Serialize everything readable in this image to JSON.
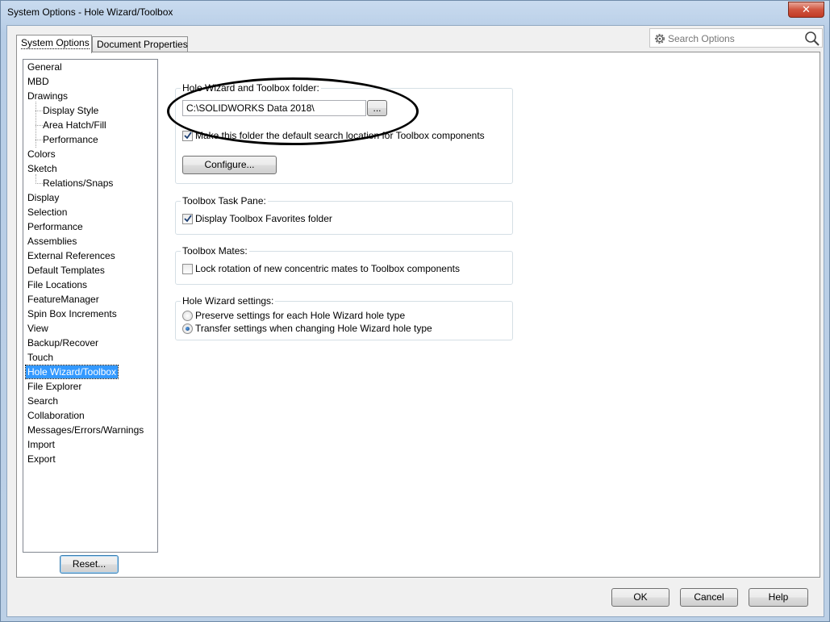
{
  "window": {
    "title": "System Options - Hole Wizard/Toolbox",
    "close_label": "✕"
  },
  "tabs": [
    {
      "label": "System Options",
      "active": true
    },
    {
      "label": "Document Properties",
      "active": false
    }
  ],
  "search": {
    "placeholder": "Search Options"
  },
  "tree": {
    "items": [
      {
        "label": "General"
      },
      {
        "label": "MBD"
      },
      {
        "label": "Drawings"
      },
      {
        "label": "Display Style"
      },
      {
        "label": "Area Hatch/Fill"
      },
      {
        "label": "Performance"
      },
      {
        "label": "Colors"
      },
      {
        "label": "Sketch"
      },
      {
        "label": "Relations/Snaps"
      },
      {
        "label": "Display"
      },
      {
        "label": "Selection"
      },
      {
        "label": "Performance"
      },
      {
        "label": "Assemblies"
      },
      {
        "label": "External References"
      },
      {
        "label": "Default Templates"
      },
      {
        "label": "File Locations"
      },
      {
        "label": "FeatureManager"
      },
      {
        "label": "Spin Box Increments"
      },
      {
        "label": "View"
      },
      {
        "label": "Backup/Recover"
      },
      {
        "label": "Touch"
      },
      {
        "label": "Hole Wizard/Toolbox",
        "selected": true
      },
      {
        "label": "File Explorer"
      },
      {
        "label": "Search"
      },
      {
        "label": "Collaboration"
      },
      {
        "label": "Messages/Errors/Warnings"
      },
      {
        "label": "Import"
      },
      {
        "label": "Export"
      }
    ]
  },
  "folder_group": {
    "label": "Hole Wizard and Toolbox folder:",
    "path": "C:\\SOLIDWORKS Data 2018\\",
    "browse_label": "...",
    "default_search_label": "Make this folder the default search location for Toolbox components",
    "default_search_checked": true,
    "configure_label": "Configure..."
  },
  "task_pane_group": {
    "label": "Toolbox Task Pane:",
    "favorites_label": "Display Toolbox Favorites folder",
    "favorites_checked": true
  },
  "mates_group": {
    "label": "Toolbox Mates:",
    "lock_label": "Lock rotation of new concentric mates to Toolbox components",
    "lock_checked": false
  },
  "hole_wizard_group": {
    "label": "Hole Wizard settings:",
    "preserve_label": "Preserve settings for each Hole Wizard hole type",
    "transfer_label": "Transfer settings when changing Hole Wizard hole type",
    "selected": "transfer"
  },
  "buttons": {
    "reset": "Reset...",
    "ok": "OK",
    "cancel": "Cancel",
    "help": "Help"
  },
  "colors": {
    "selection": "#3399ff",
    "title_bar": "#c9dbef",
    "close": "#c13b24"
  }
}
